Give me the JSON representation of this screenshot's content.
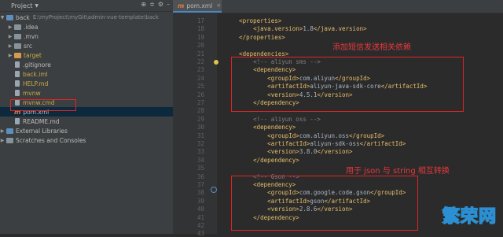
{
  "project_panel": {
    "title": "Project",
    "root_name": "back",
    "root_path": "E:\\myProject\\myGit\\admin-vue-template\\back",
    "items": [
      {
        "label": ".idea",
        "kind": "folder"
      },
      {
        "label": ".mvn",
        "kind": "folder"
      },
      {
        "label": "src",
        "kind": "folder"
      },
      {
        "label": "target",
        "kind": "folder-orange"
      },
      {
        "label": ".gitignore",
        "kind": "file"
      },
      {
        "label": "back.iml",
        "kind": "file"
      },
      {
        "label": "HELP.md",
        "kind": "file"
      },
      {
        "label": "mvnw",
        "kind": "file"
      },
      {
        "label": "mvnw.cmd",
        "kind": "file"
      },
      {
        "label": "pom.xml",
        "kind": "maven"
      },
      {
        "label": "README.md",
        "kind": "file"
      }
    ],
    "external_libraries": "External Libraries",
    "scratches": "Scratches and Consoles"
  },
  "editor": {
    "tab": "pom.xml",
    "line_numbers": [
      "17",
      "18",
      "19",
      "20",
      "21",
      "22",
      "23",
      "24",
      "25",
      "26",
      "27",
      "28",
      "29",
      "30",
      "31",
      "32",
      "33",
      "34",
      "35",
      "36",
      "37",
      "38",
      "39",
      "40",
      "41",
      "42",
      "43"
    ],
    "lines": [
      "    <properties>",
      "        <java.version>1.8</java.version>",
      "    </properties>",
      "",
      "    <dependencies>",
      "        <!-- aliyun sms -->",
      "        <dependency>",
      "            <groupId>com.aliyun</groupId>",
      "            <artifactId>aliyun-java-sdk-core</artifactId>",
      "            <version>4.5.1</version>",
      "        </dependency>",
      "",
      "        <!-- aliyun oss -->",
      "        <dependency>",
      "            <groupId>com.aliyun.oss</groupId>",
      "            <artifactId>aliyun-sdk-oss</artifactId>",
      "            <version>3.8.0</version>",
      "        </dependency>",
      "",
      "        <!-- Gson -->",
      "        <dependency>",
      "            <groupId>com.google.code.gson</groupId>",
      "            <artifactId>gson</artifactId>",
      "            <version>2.8.6</version>",
      "        </dependency>",
      "",
      ""
    ]
  },
  "annotations": {
    "sms_note": "添加短信发送相关依赖",
    "gson_note": "用于 json 与 string 相互转换"
  },
  "watermark": "繁荣网"
}
